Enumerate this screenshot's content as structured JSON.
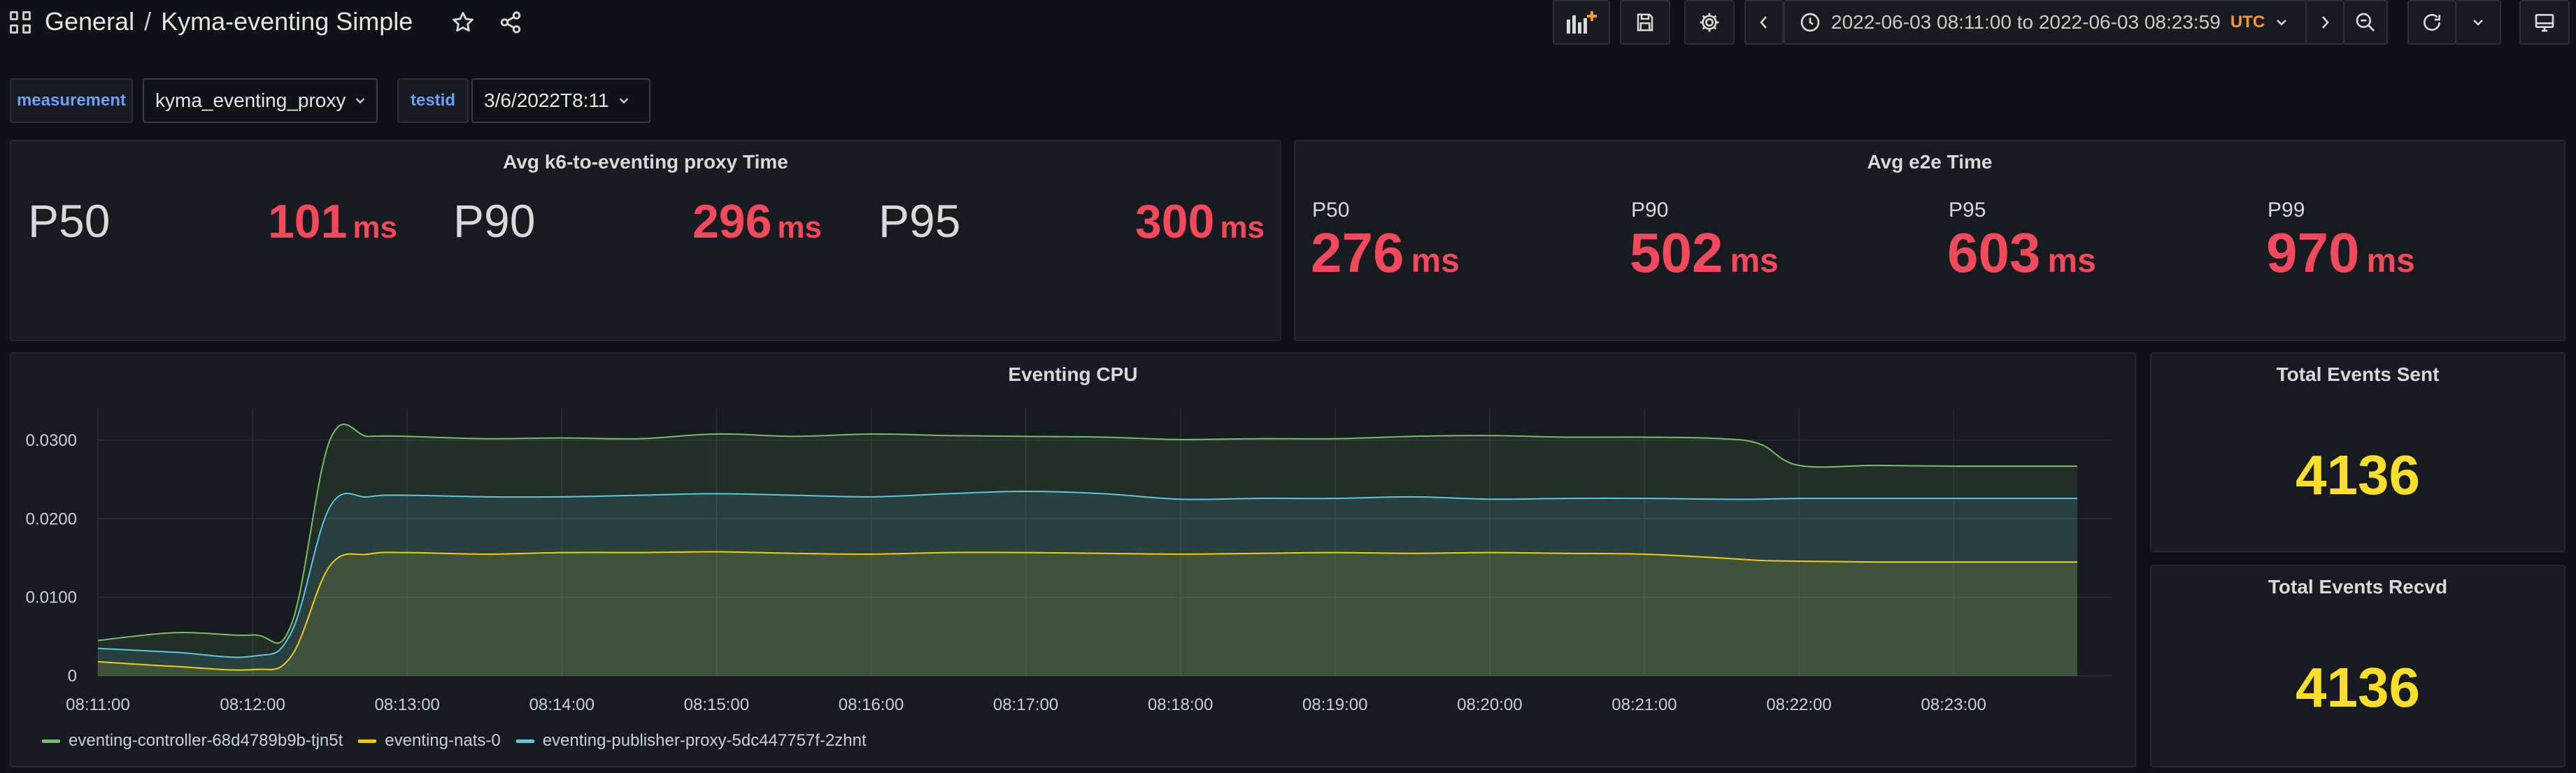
{
  "breadcrumb": {
    "folder": "General",
    "separator": "/",
    "dashboard": "Kyma-eventing Simple"
  },
  "time_range": {
    "text": "2022-06-03 08:11:00 to 2022-06-03 08:23:59",
    "timezone": "UTC"
  },
  "variables": [
    {
      "label": "measurement",
      "value": "kyma_eventing_proxy"
    },
    {
      "label": "testid",
      "value": "3/6/2022T8:11"
    }
  ],
  "panels": {
    "proxy_time": {
      "title": "Avg k6-to-eventing proxy Time",
      "stats": [
        {
          "name": "P50",
          "value": "101",
          "unit": "ms"
        },
        {
          "name": "P90",
          "value": "296",
          "unit": "ms"
        },
        {
          "name": "P95",
          "value": "300",
          "unit": "ms"
        }
      ]
    },
    "e2e_time": {
      "title": "Avg e2e Time",
      "stats": [
        {
          "name": "P50",
          "value": "276",
          "unit": "ms"
        },
        {
          "name": "P90",
          "value": "502",
          "unit": "ms"
        },
        {
          "name": "P95",
          "value": "603",
          "unit": "ms"
        },
        {
          "name": "P99",
          "value": "970",
          "unit": "ms"
        }
      ]
    },
    "cpu": {
      "title": "Eventing CPU"
    },
    "events_sent": {
      "title": "Total Events Sent",
      "value": "4136"
    },
    "events_recvd": {
      "title": "Total Events Recvd",
      "value": "4136"
    }
  },
  "colors": {
    "stat_red": "#f2495c",
    "stat_yellow": "#fade2a",
    "timezone_orange": "#ff9830",
    "variable_label_blue": "#6e9fff"
  },
  "icons": [
    "apps-icon",
    "star-icon",
    "share-icon",
    "add-panel-icon",
    "save-icon",
    "settings-icon",
    "chevron-left-icon",
    "clock-icon",
    "chevron-down-icon",
    "chevron-right-icon",
    "zoom-out-icon",
    "refresh-icon",
    "tv-icon"
  ],
  "chart_data": {
    "type": "area",
    "title": "Eventing CPU",
    "x": [
      "08:11:00",
      "08:11:30",
      "08:12:00",
      "08:12:15",
      "08:12:30",
      "08:12:45",
      "08:13:00",
      "08:13:30",
      "08:14:00",
      "08:14:30",
      "08:15:00",
      "08:15:30",
      "08:16:00",
      "08:16:30",
      "08:17:00",
      "08:17:30",
      "08:18:00",
      "08:18:30",
      "08:19:00",
      "08:19:30",
      "08:20:00",
      "08:20:30",
      "08:21:00",
      "08:21:30",
      "08:21:45",
      "08:22:00",
      "08:22:30",
      "08:23:00",
      "08:23:30",
      "08:23:48"
    ],
    "x_ticks": [
      "08:11:00",
      "08:12:00",
      "08:13:00",
      "08:14:00",
      "08:15:00",
      "08:16:00",
      "08:17:00",
      "08:18:00",
      "08:19:00",
      "08:20:00",
      "08:21:00",
      "08:22:00",
      "08:23:00"
    ],
    "y_ticks": [
      "0",
      "0.0100",
      "0.0200",
      "0.0300"
    ],
    "ylim": [
      0,
      0.034
    ],
    "series": [
      {
        "name": "eventing-controller-68d4789b9b-tjn5t",
        "color": "#73bf69",
        "values": [
          0.0045,
          0.0055,
          0.0052,
          0.0065,
          0.03,
          0.0305,
          0.0305,
          0.0302,
          0.0303,
          0.0302,
          0.0308,
          0.0305,
          0.0308,
          0.0306,
          0.0305,
          0.0304,
          0.0301,
          0.0302,
          0.0302,
          0.0305,
          0.0306,
          0.0304,
          0.0304,
          0.0302,
          0.0295,
          0.0268,
          0.0268,
          0.0267,
          0.0267,
          0.0267
        ]
      },
      {
        "name": "eventing-nats-0",
        "color": "#f2cc0c",
        "values": [
          0.0018,
          0.0012,
          0.0008,
          0.0025,
          0.014,
          0.0155,
          0.0157,
          0.0155,
          0.0157,
          0.0157,
          0.0158,
          0.0156,
          0.0155,
          0.0157,
          0.0157,
          0.0156,
          0.0155,
          0.0156,
          0.0157,
          0.0156,
          0.0157,
          0.0156,
          0.0155,
          0.015,
          0.0147,
          0.0146,
          0.0145,
          0.0145,
          0.0145,
          0.0145
        ]
      },
      {
        "name": "eventing-publisher-proxy-5dc447757f-2zhnt",
        "color": "#5bc8e0",
        "values": [
          0.0035,
          0.003,
          0.0025,
          0.0055,
          0.0215,
          0.0228,
          0.023,
          0.0228,
          0.0228,
          0.023,
          0.0232,
          0.023,
          0.0228,
          0.0232,
          0.0235,
          0.0232,
          0.0225,
          0.0226,
          0.0226,
          0.0228,
          0.0225,
          0.0226,
          0.0226,
          0.0225,
          0.0225,
          0.0226,
          0.0226,
          0.0226,
          0.0226,
          0.0226
        ]
      }
    ],
    "legend_position": "bottom-left",
    "grid": true
  }
}
